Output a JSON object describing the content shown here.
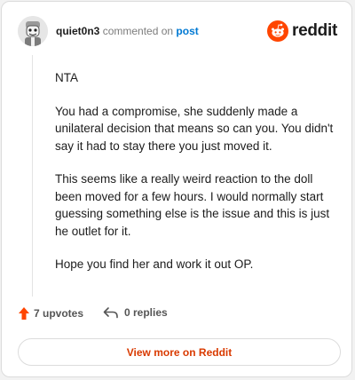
{
  "header": {
    "username": "quiet0n3",
    "action_text": "commented on",
    "post_link": "post",
    "logo_text": "reddit",
    "logo_icon": "reddit-snoo-icon"
  },
  "comment": {
    "paragraphs": [
      "NTA",
      "You had a compromise, she suddenly made a unilateral decision that means so can you. You didn't say it had to stay there you just moved it.",
      "This seems like a really weird reaction to the doll been moved for a few hours. I would normally start guessing something else is the issue and this is just he outlet for it.",
      "Hope you find her and work it out OP."
    ]
  },
  "footer": {
    "upvotes_label": "7 upvotes",
    "upvote_icon": "upvote-arrow-icon",
    "replies_label": "0 replies",
    "reply_icon": "reply-arrow-icon"
  },
  "cta": {
    "label": "View more on Reddit"
  },
  "colors": {
    "brand": "#ff4500",
    "link": "#0079d3",
    "cta_text": "#d93a00"
  }
}
